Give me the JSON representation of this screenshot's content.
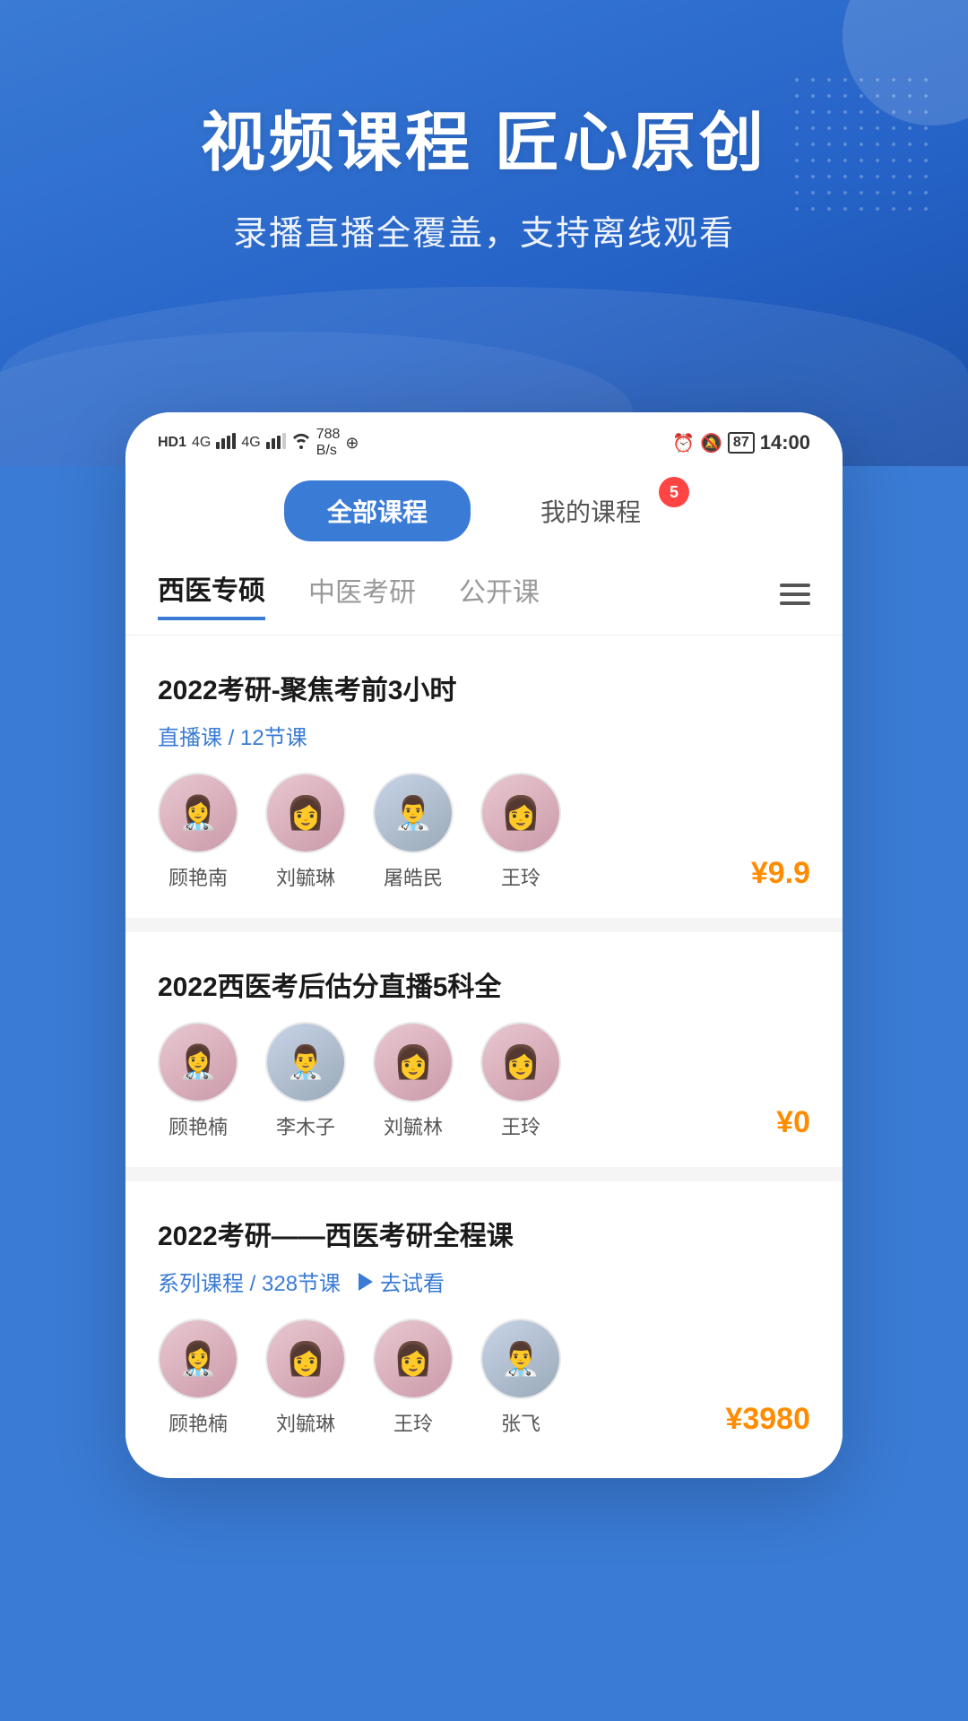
{
  "hero": {
    "title": "视频课程 匠心原创",
    "subtitle": "录播直播全覆盖，支持离线观看"
  },
  "statusBar": {
    "left": "HD1 4G 4G 788 B/s",
    "rightBattery": "87",
    "time": "14:00"
  },
  "tabs": [
    {
      "id": "all",
      "label": "全部课程",
      "active": true,
      "badge": null
    },
    {
      "id": "my",
      "label": "我的课程",
      "active": false,
      "badge": "5"
    }
  ],
  "categories": [
    {
      "id": "western",
      "label": "西医专硕",
      "active": true
    },
    {
      "id": "tcm",
      "label": "中医考研",
      "active": false
    },
    {
      "id": "open",
      "label": "公开课",
      "active": false
    }
  ],
  "courses": [
    {
      "id": 1,
      "title": "2022考研-聚焦考前3小时",
      "metaType": "直播课 / 12节课",
      "trialLabel": null,
      "teachers": [
        {
          "name": "顾艳南",
          "gender": "f"
        },
        {
          "name": "刘毓琳",
          "gender": "f"
        },
        {
          "name": "屠皓民",
          "gender": "m"
        },
        {
          "name": "王玲",
          "gender": "f"
        }
      ],
      "price": "¥9.9"
    },
    {
      "id": 2,
      "title": "2022西医考后估分直播5科全",
      "metaType": null,
      "trialLabel": null,
      "teachers": [
        {
          "name": "顾艳楠",
          "gender": "f"
        },
        {
          "name": "李木子",
          "gender": "m"
        },
        {
          "name": "刘毓林",
          "gender": "f"
        },
        {
          "name": "王玲",
          "gender": "f"
        }
      ],
      "price": "¥0"
    },
    {
      "id": 3,
      "title": "2022考研——西医考研全程课",
      "metaType": "系列课程 / 328节课",
      "trialLabel": "去试看",
      "teachers": [
        {
          "name": "顾艳楠",
          "gender": "f"
        },
        {
          "name": "刘毓琳",
          "gender": "f"
        },
        {
          "name": "王玲",
          "gender": "f"
        },
        {
          "name": "张飞",
          "gender": "m"
        }
      ],
      "price": "¥3980"
    }
  ]
}
